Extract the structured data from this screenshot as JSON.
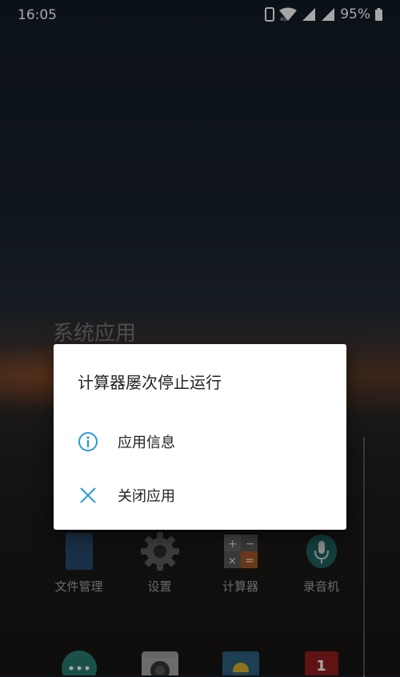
{
  "status_bar": {
    "time": "16:05",
    "battery": "95%"
  },
  "folder": {
    "title": "系统应用"
  },
  "dialog": {
    "title": "计算器屡次停止运行",
    "items": [
      {
        "label": "应用信息",
        "icon": "info-icon"
      },
      {
        "label": "关闭应用",
        "icon": "close-icon"
      }
    ],
    "accent": "#2a9ad8"
  },
  "apps": [
    {
      "label": "文件管理",
      "icon": "file-manager-icon"
    },
    {
      "label": "设置",
      "icon": "settings-gear-icon"
    },
    {
      "label": "计算器",
      "icon": "calculator-icon"
    },
    {
      "label": "录音机",
      "icon": "recorder-mic-icon"
    }
  ],
  "dock": [
    {
      "icon": "more-apps-icon"
    },
    {
      "icon": "camera-icon"
    },
    {
      "icon": "weather-icon"
    },
    {
      "icon": "calendar-icon",
      "text": "1"
    }
  ]
}
